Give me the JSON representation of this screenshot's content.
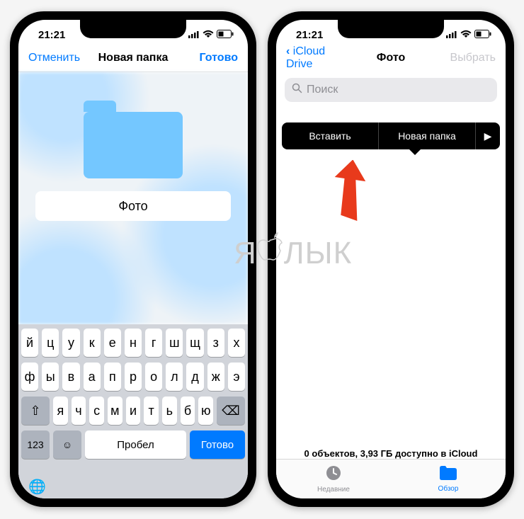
{
  "status": {
    "time": "21:21"
  },
  "left": {
    "nav": {
      "cancel": "Отменить",
      "title": "Новая папка",
      "done": "Готово"
    },
    "folder_name": "Фото",
    "keyboard": {
      "row1": [
        "й",
        "ц",
        "у",
        "к",
        "е",
        "н",
        "г",
        "ш",
        "щ",
        "з",
        "х"
      ],
      "row2": [
        "ф",
        "ы",
        "в",
        "а",
        "п",
        "р",
        "о",
        "л",
        "д",
        "ж",
        "э"
      ],
      "row3": [
        "я",
        "ч",
        "с",
        "м",
        "и",
        "т",
        "ь",
        "б",
        "ю"
      ],
      "shift": "⇧",
      "backspace": "⌫",
      "numbers": "123",
      "emoji": "☺",
      "space": "Пробел",
      "return": "Готово",
      "globe": "🌐"
    }
  },
  "right": {
    "nav": {
      "back": "iCloud Drive",
      "title": "Фото",
      "select": "Выбрать"
    },
    "search_placeholder": "Поиск",
    "menu": {
      "paste": "Вставить",
      "new_folder": "Новая папка",
      "more": "▶"
    },
    "status_line": "0 объектов, 3,93 ГБ доступно в iCloud",
    "tabs": {
      "recents": "Недавние",
      "browse": "Обзор"
    }
  },
  "watermark": "Я  ЛЫК"
}
